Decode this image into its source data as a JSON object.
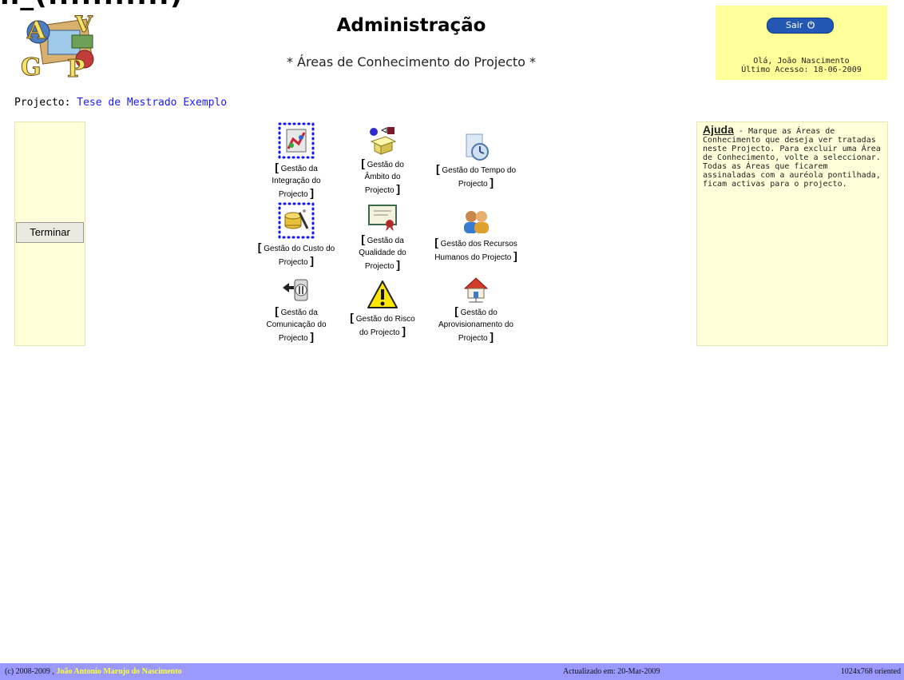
{
  "header": {
    "top_cut_text": "n_(...........)",
    "title": "Administração",
    "subtitle": "* Áreas de Conhecimento do Projecto *",
    "logo_letters": [
      "A",
      "V",
      "G",
      "P"
    ]
  },
  "user": {
    "logout_label": "Sair",
    "greeting": "Olá, João Nascimento",
    "last_access": "Último Acesso: 18-06-2009"
  },
  "project": {
    "label": "Projecto:",
    "name": "Tese de Mestrado Exemplo"
  },
  "actions": {
    "finish_label": "Terminar"
  },
  "knowledge_areas": [
    {
      "line1": "Gestão da",
      "line2": "Integração do",
      "line3": "Projecto",
      "icon": "integration-icon",
      "selected": true
    },
    {
      "line1": "Gestão do",
      "line2": "Âmbito do",
      "line3": "Projecto",
      "icon": "scope-box-icon",
      "selected": false
    },
    {
      "line1": "Gestão do Tempo do",
      "line2": "Projecto",
      "line3": "",
      "icon": "clock-document-icon",
      "selected": false
    },
    {
      "line1": "Gestão do Custo do",
      "line2": "Projecto",
      "line3": "",
      "icon": "cost-coins-icon",
      "selected": true
    },
    {
      "line1": "Gestão da",
      "line2": "Qualidade do",
      "line3": "Projecto",
      "icon": "certificate-icon",
      "selected": false
    },
    {
      "line1": "Gestão dos Recursos",
      "line2": "Humanos do Projecto",
      "line3": "",
      "icon": "people-icon",
      "selected": false
    },
    {
      "line1": "Gestão da",
      "line2": "Comunicação do",
      "line3": "Projecto",
      "icon": "communication-icon",
      "selected": false
    },
    {
      "line1": "Gestão do Risco",
      "line2": "do Projecto",
      "line3": "",
      "icon": "warning-icon",
      "selected": false
    },
    {
      "line1": "Gestão do",
      "line2": "Aprovisionamento do",
      "line3": "Projecto",
      "icon": "house-network-icon",
      "selected": false
    }
  ],
  "help": {
    "title": "Ajuda",
    "text": " - Marque as Áreas de Conhecimento que deseja ver tratadas neste Projecto. Para excluir uma Área de Conhecimento, volte a seleccionar. Todas as Áreas que ficarem assinaladas com a auréola pontilhada, ficam activas para o projecto."
  },
  "footer": {
    "copyright": "(c) 2008-2009 ,",
    "author": "João Antonio Marujo do Nascimento",
    "updated": "Actualizado em: 20-Mar-2009",
    "resolution": "1024x768 oriented"
  },
  "colors": {
    "panel_bg": "#ffffd9",
    "user_box_bg": "#ffff99",
    "footer_bg": "#9999ff",
    "link_blue": "#1a1aff",
    "button_blue": "#2257b3"
  }
}
